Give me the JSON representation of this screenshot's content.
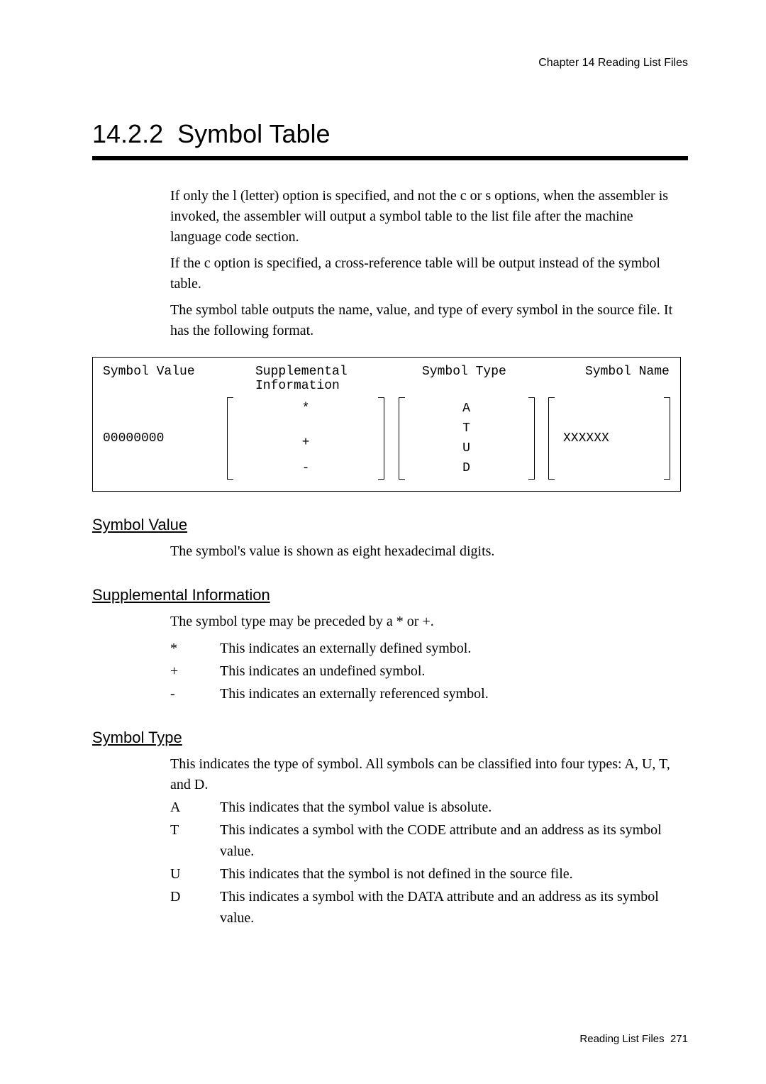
{
  "chapter_header": "Chapter  14  Reading List Files",
  "section": {
    "number": "14.2.2",
    "title": "Symbol Table"
  },
  "intro": {
    "p1": "If only the l (letter) option is specified, and not the c or s options, when the assembler is invoked, the assembler will output a symbol table to the list file after the machine language code section.",
    "p2": "If the c option is specified, a cross-reference table will be output instead of the symbol table.",
    "p3": "The symbol table outputs the name, value, and type of every symbol in the source file.  It has the following format."
  },
  "fmt": {
    "headers": {
      "c1": "Symbol Value",
      "c2a": "Supplemental",
      "c2b": "Information",
      "c3": "Symbol Type",
      "c4": "Symbol Name"
    },
    "col1_value": "00000000",
    "supp": {
      "r1": "*",
      "r2": "",
      "r3": "+",
      "r4": "-"
    },
    "type": {
      "r1": "A",
      "r2": "T",
      "r3": "U",
      "r4": "D"
    },
    "name": "XXXXXX"
  },
  "symbol_value": {
    "heading": "Symbol Value",
    "text": "The symbol's value is shown as eight hexadecimal digits."
  },
  "supp_info": {
    "heading": "Supplemental Information",
    "lead": "The symbol type may be preceded by a * or +.",
    "rows": [
      {
        "sym": "*",
        "txt": "This indicates an externally defined symbol."
      },
      {
        "sym": "+",
        "txt": "This indicates an undefined symbol."
      },
      {
        "sym": "-",
        "txt": "This indicates an externally referenced symbol."
      }
    ]
  },
  "symbol_type": {
    "heading": "Symbol Type",
    "lead": "This indicates the type of symbol.  All symbols can be classified into four types: A, U, T, and D.",
    "rows": [
      {
        "sym": "A",
        "txt": "This indicates that the symbol value is absolute."
      },
      {
        "sym": "T",
        "txt": "This indicates a symbol with the CODE attribute and an address as its symbol value."
      },
      {
        "sym": "U",
        "txt": "This indicates that the symbol is not defined in the source file."
      },
      {
        "sym": "D",
        "txt": "This indicates a symbol with the DATA attribute and an address as its symbol value."
      }
    ]
  },
  "footer": {
    "text": "Reading List Files",
    "page": "271"
  }
}
